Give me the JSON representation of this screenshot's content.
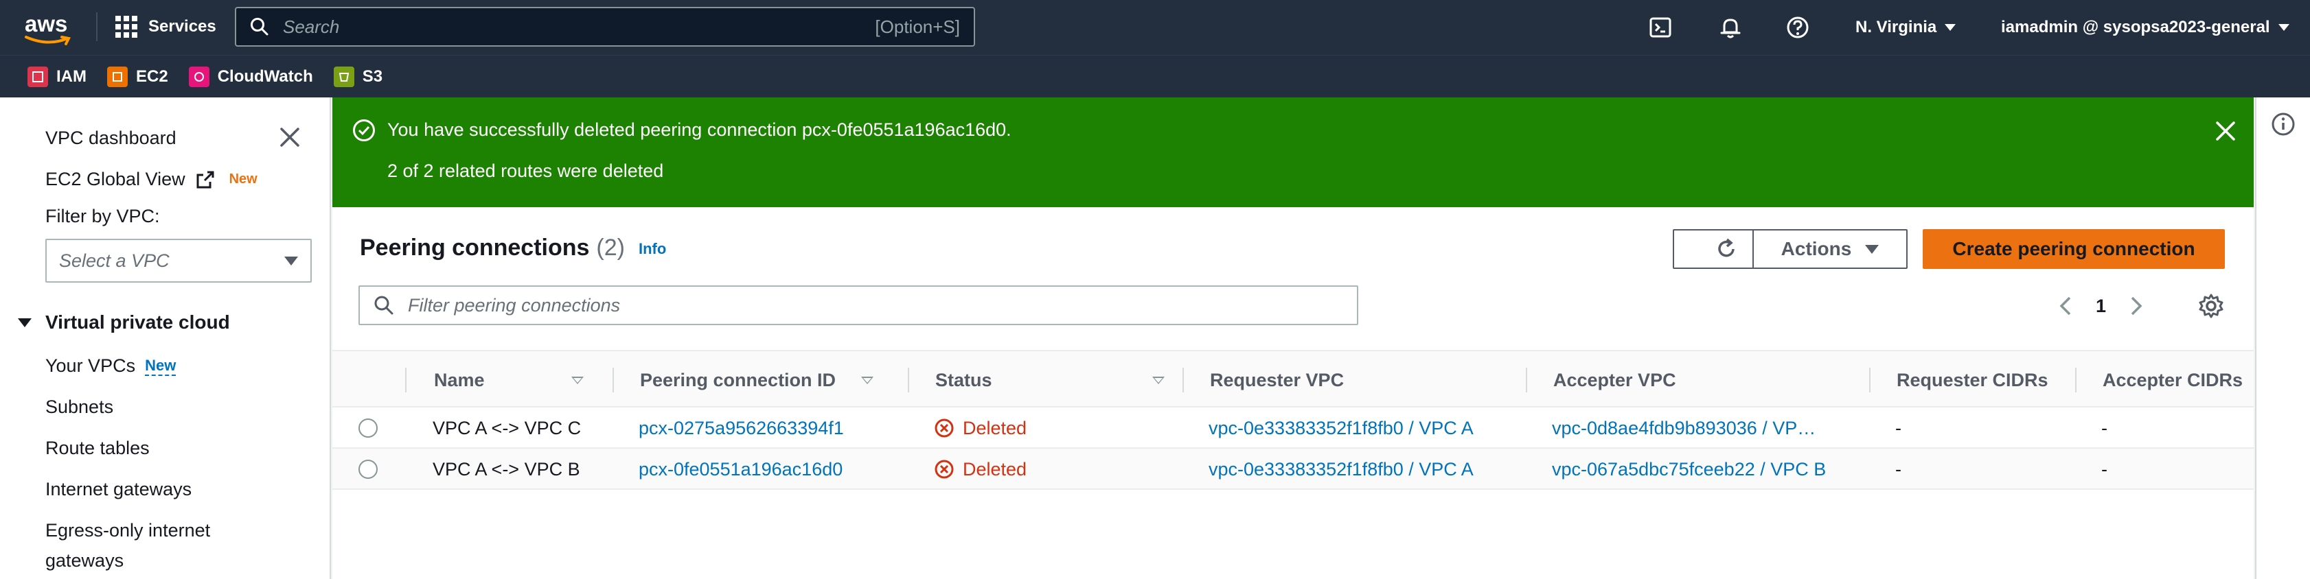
{
  "topnav": {
    "logo_text": "aws",
    "services_label": "Services",
    "search_placeholder": "Search",
    "search_shortcut": "[Option+S]",
    "region": "N. Virginia",
    "account": "iamadmin @ sysopsa2023-general"
  },
  "favorites": [
    {
      "label": "IAM",
      "color": "#dd344c"
    },
    {
      "label": "EC2",
      "color": "#ed7100"
    },
    {
      "label": "CloudWatch",
      "color": "#e7157b"
    },
    {
      "label": "S3",
      "color": "#7aa116"
    }
  ],
  "sidebar": {
    "dashboard": "VPC dashboard",
    "ec2_global_view": "EC2 Global View",
    "new_badge": "New",
    "filter_label": "Filter by VPC:",
    "filter_placeholder": "Select a VPC",
    "section": "Virtual private cloud",
    "your_vpcs": "Your VPCs",
    "your_vpcs_badge": "New",
    "items": [
      "Subnets",
      "Route tables",
      "Internet gateways",
      "Egress-only internet",
      "gateways"
    ]
  },
  "flash": {
    "message": "You have successfully deleted peering connection pcx-0fe0551a196ac16d0.",
    "detail": "2 of 2 related routes were deleted",
    "color": "#1d8102"
  },
  "panel": {
    "title": "Peering connections",
    "count": "(2)",
    "info": "Info",
    "actions_label": "Actions",
    "create_label": "Create peering connection",
    "filter_placeholder": "Filter peering connections",
    "page": "1"
  },
  "table": {
    "headers": [
      "Name",
      "Peering connection ID",
      "Status",
      "Requester VPC",
      "Accepter VPC",
      "Requester CIDRs",
      "Accepter CIDRs"
    ],
    "rows": [
      {
        "name": "VPC A <-> VPC C",
        "id": "pcx-0275a9562663394f1",
        "status": "Deleted",
        "requester": "vpc-0e33383352f1f8fb0 / VPC A",
        "accepter": "vpc-0d8ae4fdb9b893036 / VP…",
        "req_cidrs": "-",
        "acc_cidrs": "-"
      },
      {
        "name": "VPC A <-> VPC B",
        "id": "pcx-0fe0551a196ac16d0",
        "status": "Deleted",
        "requester": "vpc-0e33383352f1f8fb0 / VPC A",
        "accepter": "vpc-067a5dbc75fceeb22 / VPC B",
        "req_cidrs": "-",
        "acc_cidrs": "-"
      }
    ]
  },
  "colors": {
    "nav_bg": "#232f3e",
    "link": "#0073bb",
    "primary": "#ec7211",
    "deleted": "#d13212"
  }
}
